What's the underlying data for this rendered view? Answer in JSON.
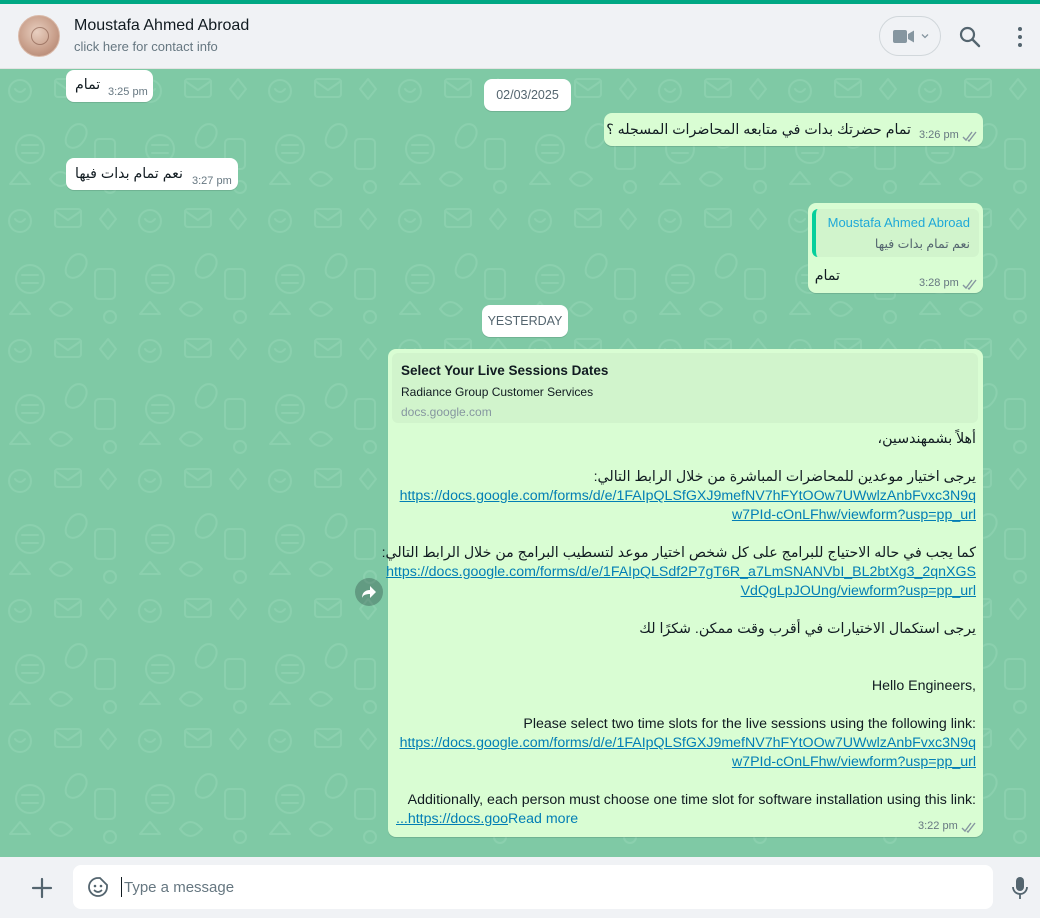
{
  "colors": {
    "accent": "#00a884",
    "chat_background": "#7fc9a5",
    "incoming_bubble": "#ffffff",
    "outgoing_bubble": "#d9fdd3",
    "link": "#027eb5",
    "read_ticks": "#8696a0"
  },
  "header": {
    "contact_name": "Moustafa Ahmed Abroad",
    "contact_subtitle": "click here for contact info",
    "icons": [
      "video-call-icon",
      "chevron-down-icon",
      "search-icon",
      "menu-icon"
    ]
  },
  "chat": {
    "messages": [
      {
        "direction": "in",
        "text": "تمام",
        "time": "3:25 pm"
      },
      {
        "type": "date",
        "text": "02/03/2025"
      },
      {
        "direction": "out",
        "text": "تمام حضرتك بدات في متابعه المحاضرات المسجله ؟",
        "time": "3:26 pm",
        "status": "read"
      },
      {
        "direction": "in",
        "text": "نعم تمام بدات فيها",
        "time": "3:27 pm"
      },
      {
        "direction": "out",
        "quote_author": "Moustafa Ahmed Abroad",
        "quote_text": "نعم تمام بدات فيها",
        "text": "تمام",
        "time": "3:28 pm",
        "status": "read"
      },
      {
        "type": "date",
        "text": "YESTERDAY"
      },
      {
        "direction": "out",
        "link_preview": {
          "title": "Select Your Live Sessions Dates",
          "subtitle": "Radiance Group Customer Services",
          "domain": "docs.google.com"
        },
        "lines": [
          "أهلاً بشمهندسين،",
          "يرجى اختيار موعدين للمحاضرات المباشرة من خلال الرابط التالي:",
          "https://docs.google.com/forms/d/e/1FAIpQLSfGXJ9mefNV7hFYtOOw7UWwlzAnbFvxc3N9q",
          "w7PId-cOnLFhw/viewform?usp=pp_url",
          "كما يجب في حاله الاحتياج للبرامج على كل شخص اختيار موعد لتسطيب البرامج من خلال الرابط التالي:",
          "https://docs.google.com/forms/d/e/1FAIpQLSdf2P7gT6R_a7LmSNANVbI_BL2btXg3_2qnXGS",
          "VdQgLpJOUng/viewform?usp=pp_url",
          "يرجى استكمال الاختيارات في أقرب وقت ممكن. شكرًا لك",
          "Hello Engineers,",
          "Please select two time slots for the live sessions using the following link:",
          "https://docs.google.com/forms/d/e/1FAIpQLSfGXJ9mefNV7hFYtOOw7UWwlzAnbFvxc3N9q",
          "w7PId-cOnLFhw/viewform?usp=pp_url",
          "Additionally, each person must choose one time slot for software installation using this link:",
          "...https://docs.goo"
        ],
        "read_more": "Read more",
        "time": "3:22 pm",
        "status": "read"
      }
    ]
  },
  "composer": {
    "placeholder": "Type a message",
    "icons": [
      "plus-icon",
      "emoji-icon",
      "microphone-icon"
    ]
  }
}
